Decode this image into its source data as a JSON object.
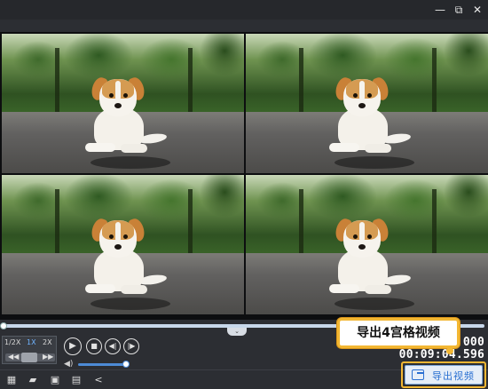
{
  "window": {
    "minimize_icon": "minimize-icon",
    "restore_icon": "restore-icon",
    "close_icon": "close-icon",
    "minimize_glyph": "—",
    "restore_glyph": "⧉",
    "close_glyph": "✕"
  },
  "video": {
    "layout": "4-grid",
    "tiles": [
      "tile-1",
      "tile-2",
      "tile-3",
      "tile-4"
    ]
  },
  "playback": {
    "speeds": [
      "1/2X",
      "1X",
      "2X"
    ],
    "active_speed": "1X",
    "rewind_glyph": "◀◀",
    "forward_glyph": "▶▶",
    "play_glyph": "▶",
    "stop_glyph": "■",
    "prev_glyph": "◀|",
    "next_glyph": "|▶",
    "volume_glyph": "◀)"
  },
  "time": {
    "total": "000",
    "current": "00:09:04.596"
  },
  "tooltip": {
    "text": "导出4宫格视频"
  },
  "toolbar": {
    "tools": [
      {
        "name": "film-icon",
        "glyph": "▦"
      },
      {
        "name": "folder-open-icon",
        "glyph": "▰"
      },
      {
        "name": "save-icon",
        "glyph": "▣"
      },
      {
        "name": "save-as-icon",
        "glyph": "▤"
      },
      {
        "name": "share-icon",
        "glyph": "<"
      }
    ],
    "export_label": "导出视频"
  },
  "colors": {
    "accent": "#2a6fd1",
    "highlight": "#f3b733",
    "background": "#2c2e33"
  }
}
